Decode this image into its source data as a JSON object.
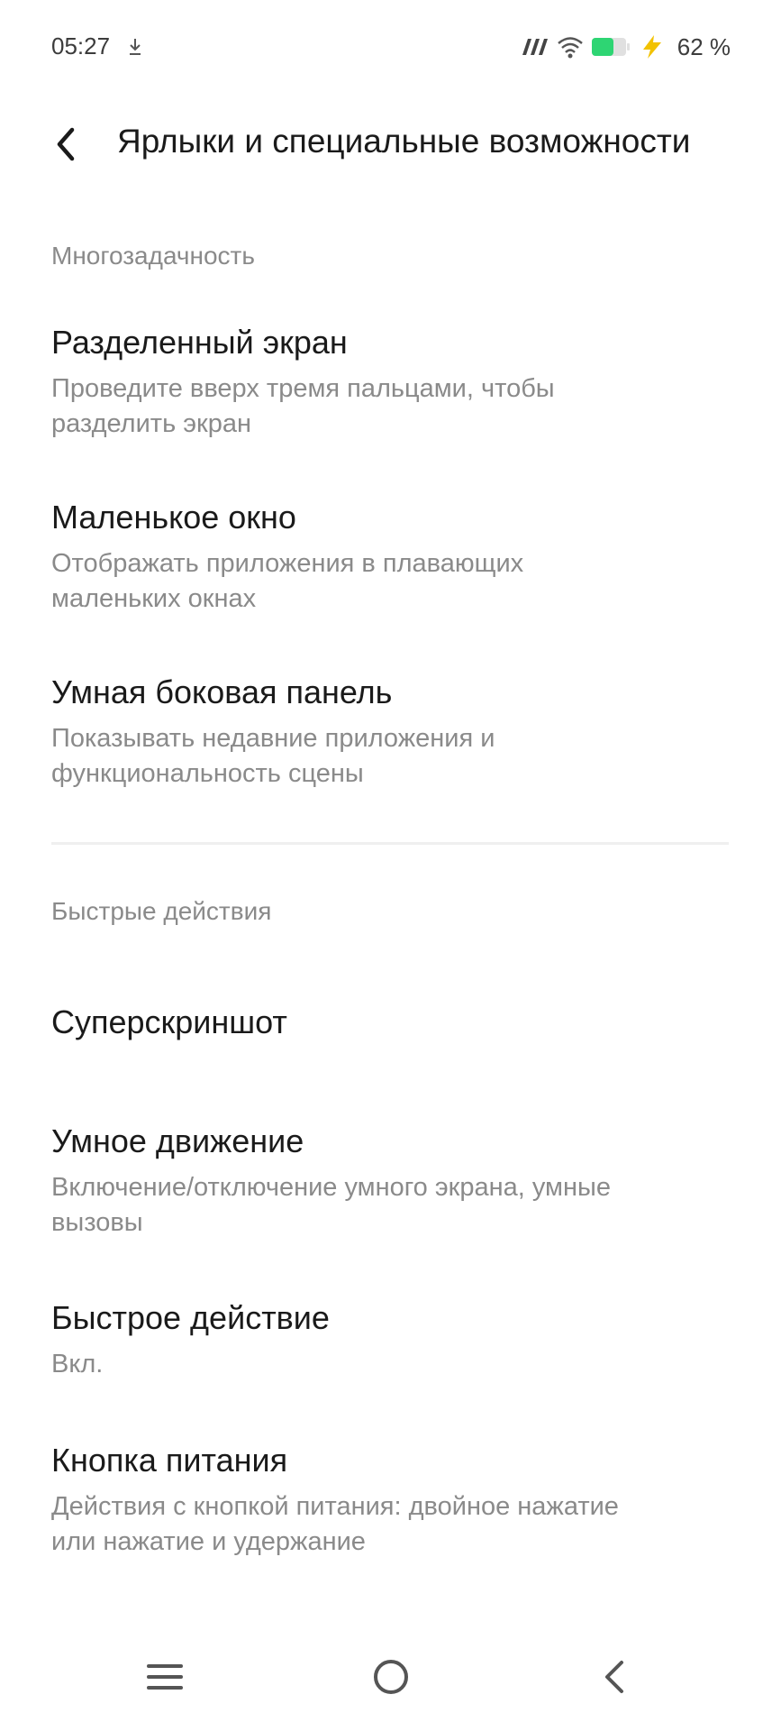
{
  "status_bar": {
    "time": "05:27",
    "battery_text": "62 %",
    "icons": [
      "download-icon",
      "carrier-icon",
      "wifi-icon",
      "battery-icon",
      "charging-icon"
    ],
    "battery_level": 0.62,
    "battery_color": "#2ed573",
    "charging_color": "#f2c200"
  },
  "header": {
    "title": "Ярлыки и специальные возможности",
    "back_icon": "chevron-left-icon"
  },
  "sections": [
    {
      "label": "Многозадачность",
      "items": [
        {
          "title": "Разделенный экран",
          "subtitle_line1": "Проведите вверх тремя пальцами, чтобы",
          "subtitle_line2": "разделить экран"
        },
        {
          "title": "Маленькое окно",
          "subtitle_line1": "Отображать приложения в плавающих",
          "subtitle_line2": "маленьких окнах"
        },
        {
          "title": "Умная боковая панель",
          "subtitle_line1": "Показывать недавние приложения и",
          "subtitle_line2": "функциональность сцены"
        }
      ]
    },
    {
      "label": "Быстрые действия",
      "items": [
        {
          "title": "Суперскриншот"
        },
        {
          "title": "Умное движение",
          "subtitle_line1": "Включение/отключение умного экрана, умные",
          "subtitle_line2": "вызовы"
        },
        {
          "title": "Быстрое действие",
          "subtitle_line1": "Вкл."
        },
        {
          "title": "Кнопка питания",
          "subtitle_line1": "Действия с кнопкой питания: двойное нажатие",
          "subtitle_line2": "или нажатие и удержание"
        }
      ]
    }
  ],
  "nav_bar": {
    "icons": [
      "menu-icon",
      "home-icon",
      "back-icon"
    ]
  }
}
